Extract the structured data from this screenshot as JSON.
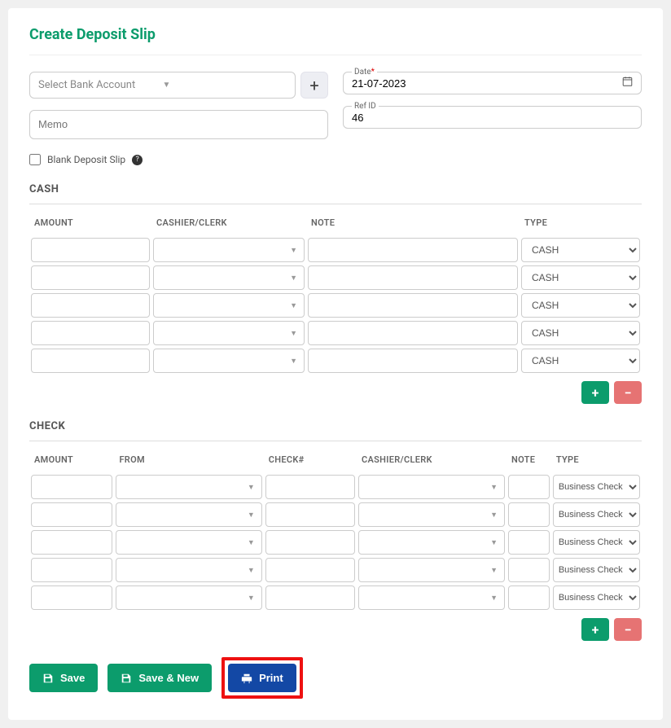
{
  "title": "Create Deposit Slip",
  "bank_placeholder": "Select Bank Account",
  "memo_placeholder": "Memo",
  "date_label": "Date",
  "date_value": "21-07-2023",
  "refid_label": "Ref ID",
  "refid_value": "46",
  "blank_label": "Blank Deposit Slip",
  "cash": {
    "title": "CASH",
    "columns": {
      "amount": "AMOUNT",
      "cashier": "CASHIER/CLERK",
      "note": "NOTE",
      "type": "TYPE"
    },
    "rows": [
      {
        "type": "CASH"
      },
      {
        "type": "CASH"
      },
      {
        "type": "CASH"
      },
      {
        "type": "CASH"
      },
      {
        "type": "CASH"
      }
    ]
  },
  "check": {
    "title": "CHECK",
    "columns": {
      "amount": "AMOUNT",
      "from": "FROM",
      "checknum": "CHECK#",
      "cashier": "CASHIER/CLERK",
      "note": "NOTE",
      "type": "TYPE"
    },
    "rows": [
      {
        "type": "Business Check"
      },
      {
        "type": "Business Check"
      },
      {
        "type": "Business Check"
      },
      {
        "type": "Business Check"
      },
      {
        "type": "Business Check"
      }
    ]
  },
  "buttons": {
    "save": "Save",
    "save_new": "Save & New",
    "print": "Print"
  },
  "colors": {
    "brand": "#0c9c6c",
    "primary_blue": "#1348a5",
    "danger": "#e67373"
  }
}
